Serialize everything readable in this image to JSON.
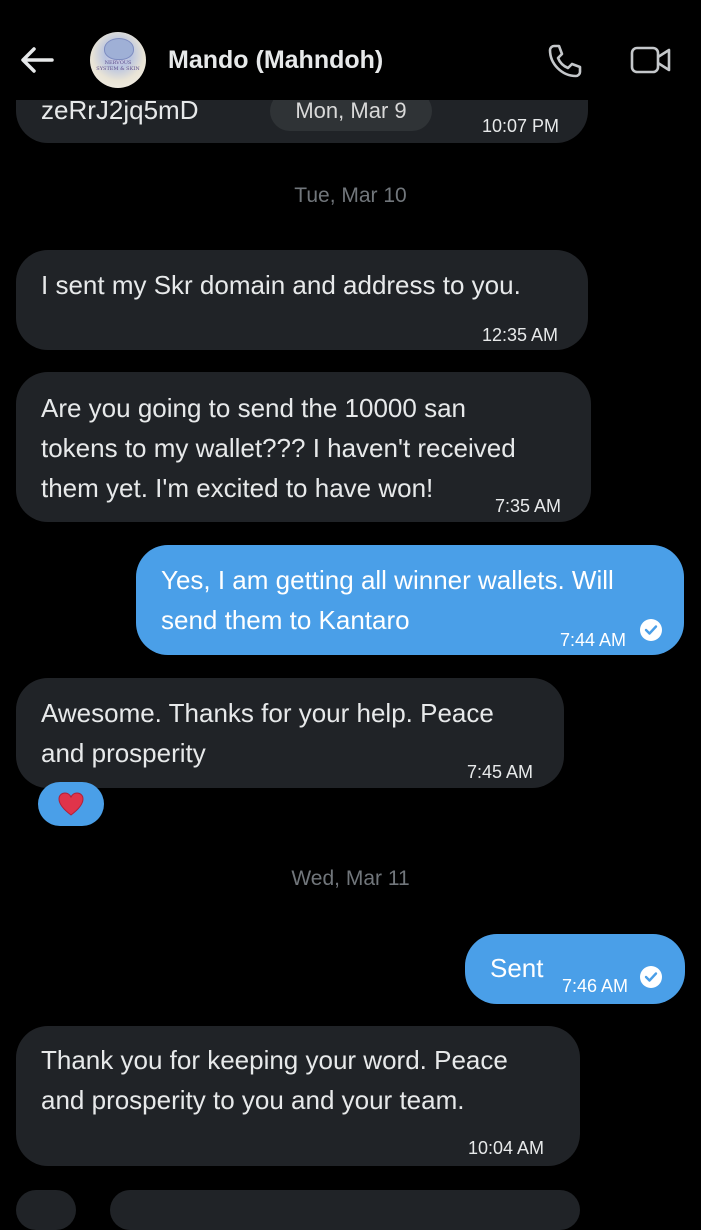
{
  "header": {
    "contact_name": "Mando (Mahndoh)",
    "avatar_text": "NERVOUS SYSTEM & SKIN",
    "back_icon": "arrow-left-icon",
    "call_icon": "phone-icon",
    "video_icon": "video-camera-icon"
  },
  "messages": [
    {
      "direction": "in",
      "text": "zeRrJ2jq5mD",
      "date_pill": "Mon, Mar 9",
      "time": "10:07 PM"
    },
    {
      "date_separator": "Tue, Mar 10"
    },
    {
      "direction": "in",
      "text": "I sent my Skr domain and address to you.",
      "time": "12:35 AM"
    },
    {
      "direction": "in",
      "lines": [
        "Are you going to send the 10000 san",
        "tokens to my wallet??? I haven't received",
        "them yet. I'm excited to have won!"
      ],
      "time": "7:35 AM"
    },
    {
      "direction": "out",
      "lines": [
        "Yes, I am getting all winner wallets. Will",
        "send them to Kantaro"
      ],
      "time": "7:44 AM",
      "status": "read"
    },
    {
      "direction": "in",
      "lines": [
        "Awesome. Thanks for your help. Peace",
        "and prosperity"
      ],
      "time": "7:45 AM",
      "reaction": "❤️"
    },
    {
      "date_separator": "Wed, Mar 11"
    },
    {
      "direction": "out",
      "text": "Sent",
      "time": "7:46 AM",
      "status": "read"
    },
    {
      "direction": "in",
      "lines": [
        "Thank you for keeping your word. Peace",
        "and prosperity to you and your team."
      ],
      "time": "10:04 AM"
    }
  ],
  "colors": {
    "background": "#000000",
    "incoming_bubble": "#202327",
    "outgoing_bubble": "#4a9fe8",
    "date_text": "#71767b"
  }
}
